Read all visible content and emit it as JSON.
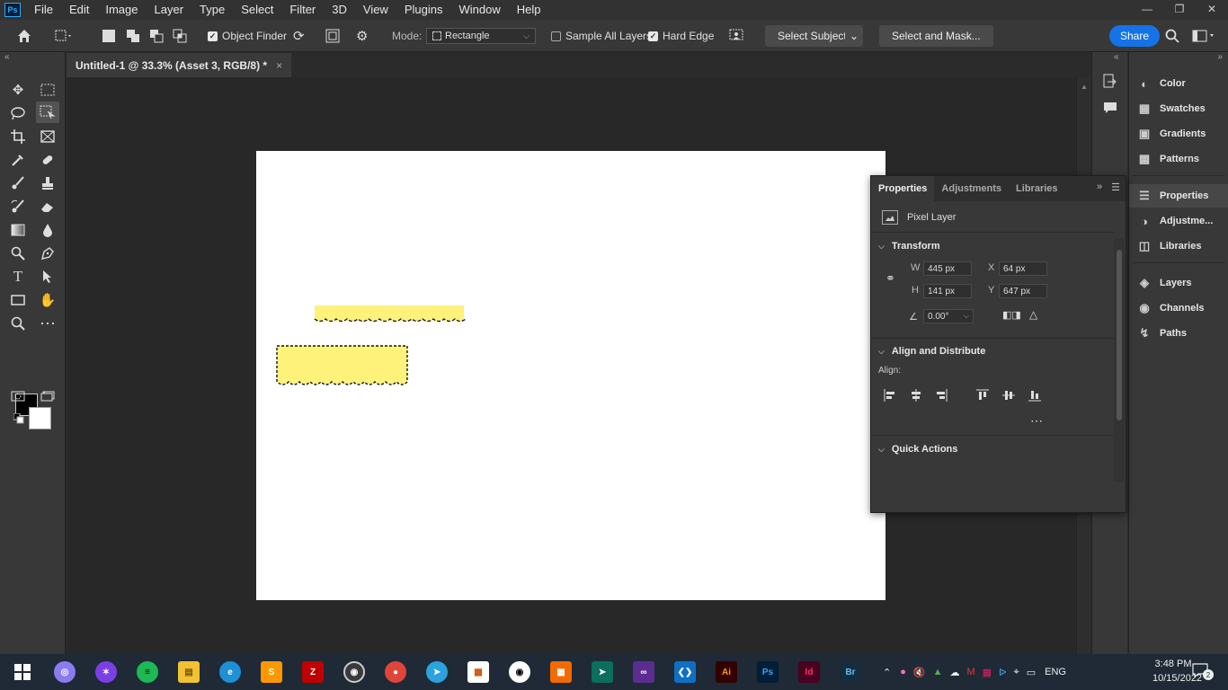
{
  "app": {
    "logo": "Ps"
  },
  "menu": [
    "File",
    "Edit",
    "Image",
    "Layer",
    "Type",
    "Select",
    "Filter",
    "3D",
    "View",
    "Plugins",
    "Window",
    "Help"
  ],
  "options": {
    "object_finder": "Object Finder",
    "mode_label": "Mode:",
    "mode_value": "Rectangle",
    "sample_all_layers": "Sample All Layers",
    "hard_edge": "Hard Edge",
    "select_subject": "Select Subject",
    "select_and_mask": "Select and Mask...",
    "share": "Share"
  },
  "document": {
    "tab_title": "Untitled-1 @ 33.3% (Asset 3, RGB/8) *",
    "close": "×"
  },
  "colors": {
    "foreground": "#000000",
    "background": "#ffffff",
    "sticky_yellow": "#fff27a",
    "accent": "#1473e6"
  },
  "right_panels": {
    "group1": [
      "Color",
      "Swatches",
      "Gradients",
      "Patterns"
    ],
    "group2": [
      "Properties",
      "Adjustme...",
      "Libraries"
    ],
    "group3": [
      "Layers",
      "Channels",
      "Paths"
    ]
  },
  "properties": {
    "tabs": [
      "Properties",
      "Adjustments",
      "Libraries"
    ],
    "layer_type": "Pixel Layer",
    "transform_title": "Transform",
    "w_label": "W",
    "w_value": "445 px",
    "h_label": "H",
    "h_value": "141 px",
    "x_label": "X",
    "x_value": "64 px",
    "y_label": "Y",
    "y_value": "647 px",
    "angle_value": "0.00°",
    "align_title": "Align and Distribute",
    "align_label": "Align:",
    "quick_actions_title": "Quick Actions"
  },
  "taskbar": {
    "time": "3:48 PM",
    "date": "10/15/2022",
    "lang": "ENG",
    "notifications": "2"
  }
}
